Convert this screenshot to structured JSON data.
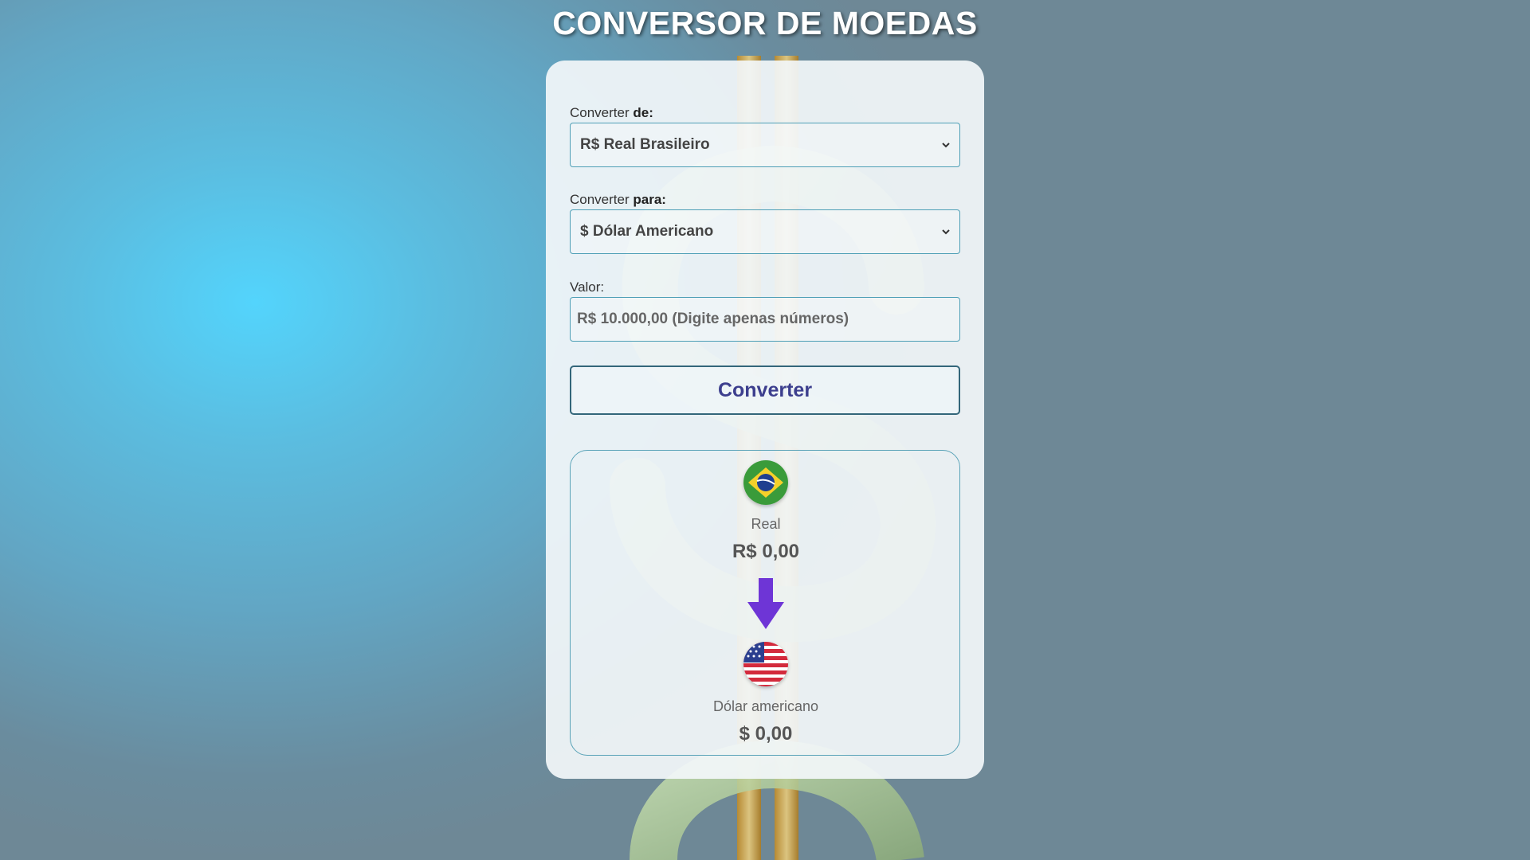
{
  "page": {
    "title": "CONVERSOR DE MOEDAS"
  },
  "form": {
    "from_label": "Converter ",
    "from_label_bold": "de:",
    "from_selected": "R$ Real Brasileiro",
    "to_label": "Converter ",
    "to_label_bold": "para:",
    "to_selected": "$ Dólar Americano",
    "value_label": "Valor:",
    "value_placeholder": "R$ 10.000,00 (Digite apenas números)",
    "value_current": "",
    "convert_button": "Converter"
  },
  "result": {
    "from_currency_name": "Real",
    "from_currency_value": "R$ 0,00",
    "from_flag_icon": "brazil-flag-icon",
    "arrow_icon": "arrow-down-icon",
    "to_currency_name": "Dólar americano",
    "to_currency_value": "$ 0,00",
    "to_flag_icon": "usa-flag-icon"
  },
  "colors": {
    "title": "#ffffff",
    "button_text": "#3d3f8e",
    "arrow": "#6e35d6",
    "border": "#4e9fb6"
  }
}
